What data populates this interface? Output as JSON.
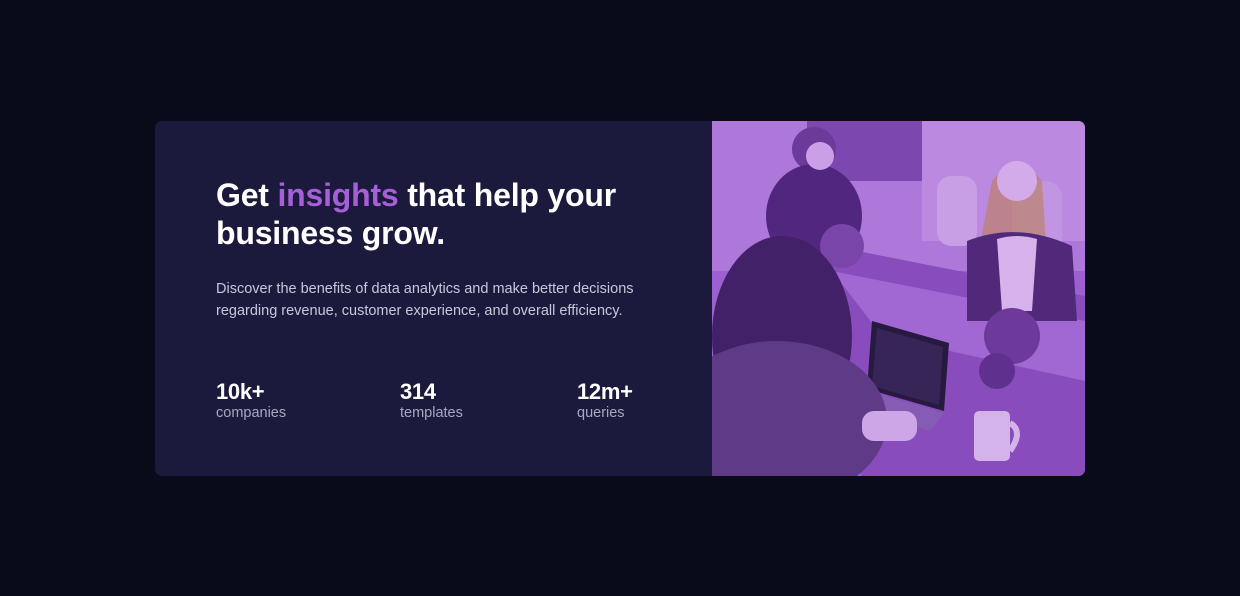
{
  "hero": {
    "headline_before": "Get ",
    "headline_accent": "insights",
    "headline_after": " that help your business grow.",
    "description": "Discover the benefits of data analytics and make better decisions regarding revenue, customer experience, and overall efficiency."
  },
  "stats": [
    {
      "value": "10k+",
      "label": "companies"
    },
    {
      "value": "314",
      "label": "templates"
    },
    {
      "value": "12m+",
      "label": "queries"
    }
  ],
  "image": {
    "subject": "people-working-at-table-photo"
  },
  "colors": {
    "background": "#090b1a",
    "card": "#1c1a3c",
    "accent": "#a75fd8",
    "image_tint": "#a368d2"
  }
}
